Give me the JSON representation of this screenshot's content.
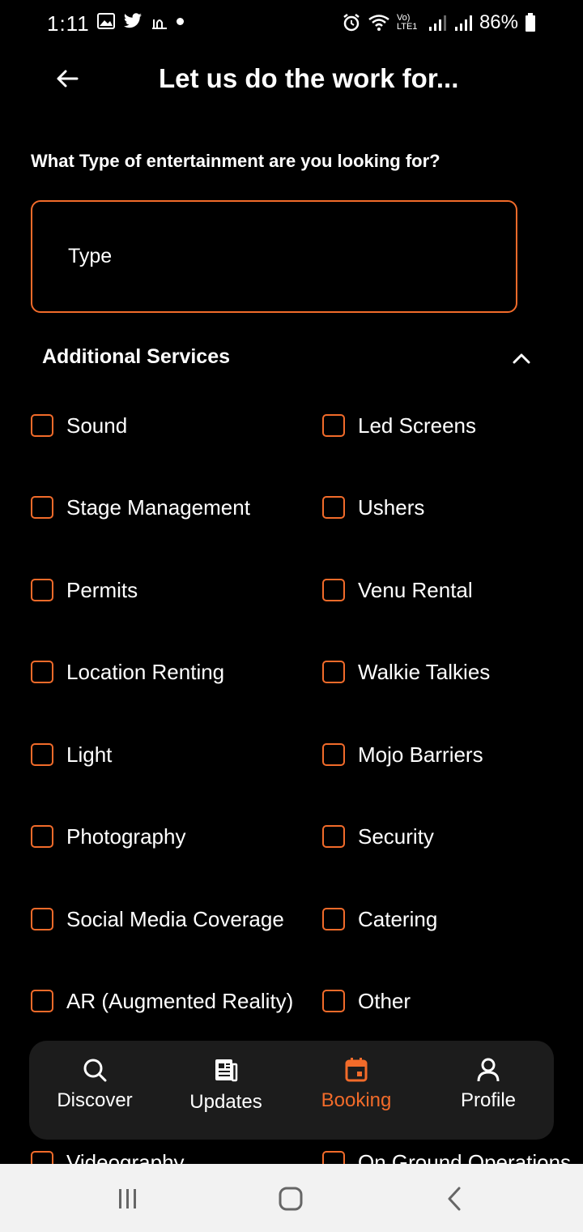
{
  "status_bar": {
    "time": "1:11",
    "battery": "86%",
    "network": "Vo) LTE1"
  },
  "header": {
    "title": "Let us do the work for..."
  },
  "question": "What Type of entertainment are you looking for?",
  "type_field": {
    "placeholder": "Type"
  },
  "additional_services": {
    "title": "Additional Services",
    "left_column": [
      "Sound",
      "Stage Management",
      "Permits",
      "Location Renting",
      "Light",
      "Photography",
      "Social Media Coverage",
      "AR (Augmented Reality)",
      "Videography"
    ],
    "right_column": [
      "Led Screens",
      "Ushers",
      "Venu Rental",
      "Walkie Talkies",
      "Mojo Barriers",
      "Security",
      "Catering",
      "Other",
      "On Ground Operations"
    ]
  },
  "bottom_nav": {
    "items": [
      {
        "label": "Discover",
        "icon": "search-icon"
      },
      {
        "label": "Updates",
        "icon": "newspaper-icon"
      },
      {
        "label": "Booking",
        "icon": "calendar-icon"
      },
      {
        "label": "Profile",
        "icon": "person-icon"
      }
    ],
    "active": "Booking"
  },
  "colors": {
    "accent": "#f26b2a",
    "background": "#000000",
    "nav_background": "#1c1c1c"
  }
}
